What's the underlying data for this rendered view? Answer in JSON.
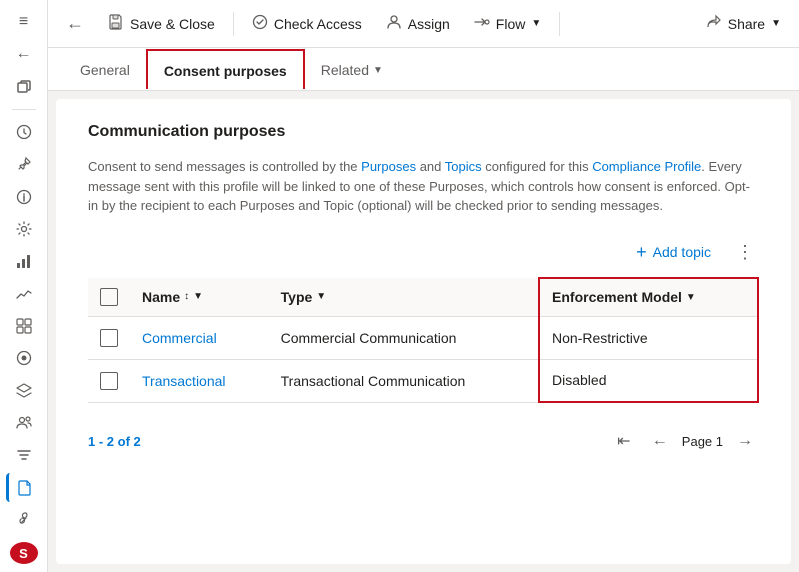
{
  "sidebar": {
    "icons": [
      {
        "name": "menu-icon",
        "symbol": "≡"
      },
      {
        "name": "back-icon",
        "symbol": "←"
      },
      {
        "name": "restore-icon",
        "symbol": "⧉"
      },
      {
        "name": "clock-icon",
        "symbol": "🕐"
      },
      {
        "name": "pin-icon",
        "symbol": "📌"
      },
      {
        "name": "info-icon",
        "symbol": "ℹ"
      },
      {
        "name": "gear-icon",
        "symbol": "⚙"
      },
      {
        "name": "chart-icon",
        "symbol": "📊"
      },
      {
        "name": "trend-icon",
        "symbol": "📈"
      },
      {
        "name": "grid-icon",
        "symbol": "⊞"
      },
      {
        "name": "toggle-icon",
        "symbol": "⊙"
      },
      {
        "name": "layers-icon",
        "symbol": "⧉"
      },
      {
        "name": "people-icon",
        "symbol": "👥"
      },
      {
        "name": "settings2-icon",
        "symbol": "⚙"
      },
      {
        "name": "document-icon",
        "symbol": "📄"
      },
      {
        "name": "link-icon",
        "symbol": "🔗"
      },
      {
        "name": "user-icon",
        "symbol": "S",
        "is_avatar": true
      }
    ]
  },
  "toolbar": {
    "save_close_label": "Save & Close",
    "check_access_label": "Check Access",
    "assign_label": "Assign",
    "flow_label": "Flow",
    "share_label": "Share",
    "save_icon": "💾",
    "check_icon": "👁",
    "assign_icon": "👤",
    "flow_icon": "➤",
    "share_icon": "↗"
  },
  "tabs": [
    {
      "label": "General",
      "active": false
    },
    {
      "label": "Consent purposes",
      "active": true
    },
    {
      "label": "Related",
      "active": false,
      "has_dropdown": true
    }
  ],
  "content": {
    "section_title": "Communication purposes",
    "info_text": "Consent to send messages is controlled by the Purposes and Topics configured for this Compliance Profile. Every message sent with this profile will be linked to one of these Purposes, which controls how consent is enforced. Opt-in by the recipient to each Purposes and Topic (optional) will be checked prior to sending messages.",
    "add_topic_label": "Add topic",
    "table": {
      "columns": [
        {
          "label": "",
          "key": "select"
        },
        {
          "label": "Name",
          "key": "name",
          "sortable": true
        },
        {
          "label": "Type",
          "key": "type",
          "sortable": true
        },
        {
          "label": "Enforcement Model",
          "key": "enforcement",
          "sortable": true,
          "highlighted": true
        }
      ],
      "rows": [
        {
          "name": "Commercial",
          "type": "Commercial Communication",
          "enforcement": "Non-Restrictive"
        },
        {
          "name": "Transactional",
          "type": "Transactional Communication",
          "enforcement": "Disabled"
        }
      ]
    },
    "pagination": {
      "summary": "1 - 2 of 2",
      "page_label": "Page 1"
    }
  }
}
